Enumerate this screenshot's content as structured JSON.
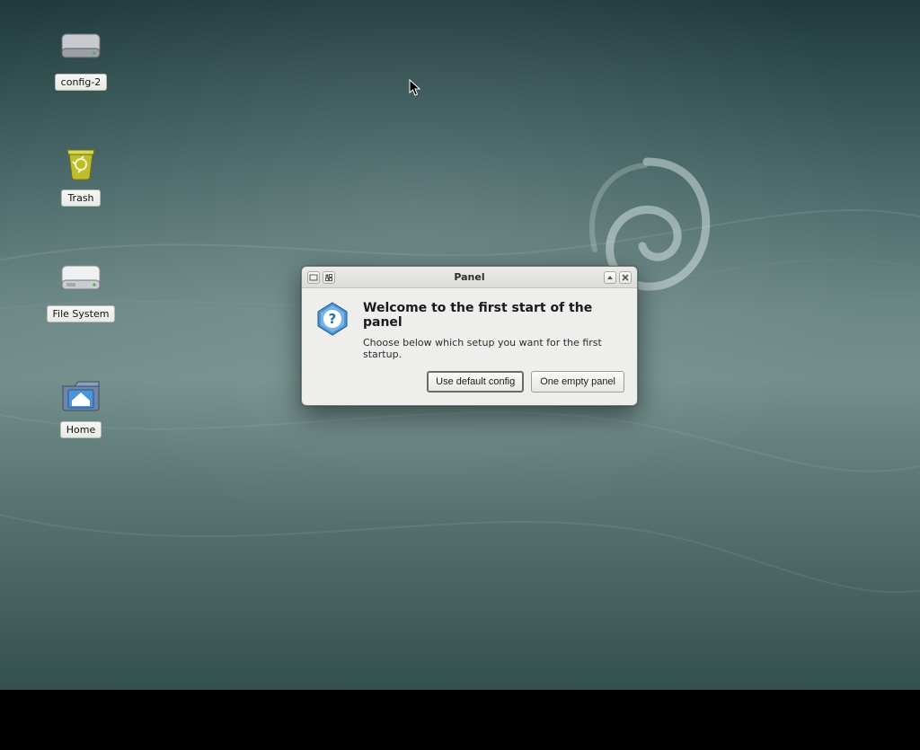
{
  "desktop": {
    "icons": [
      {
        "name": "config-2",
        "label": "config-2",
        "type": "drive"
      },
      {
        "name": "trash",
        "label": "Trash",
        "type": "trash"
      },
      {
        "name": "filesystem",
        "label": "File System",
        "type": "drive"
      },
      {
        "name": "home",
        "label": "Home",
        "type": "home"
      }
    ]
  },
  "dialog": {
    "title": "Panel",
    "heading": "Welcome to the first start of the panel",
    "body": "Choose below which setup you want for the first startup.",
    "buttons": {
      "default": "Use default config",
      "empty": "One empty panel"
    }
  }
}
